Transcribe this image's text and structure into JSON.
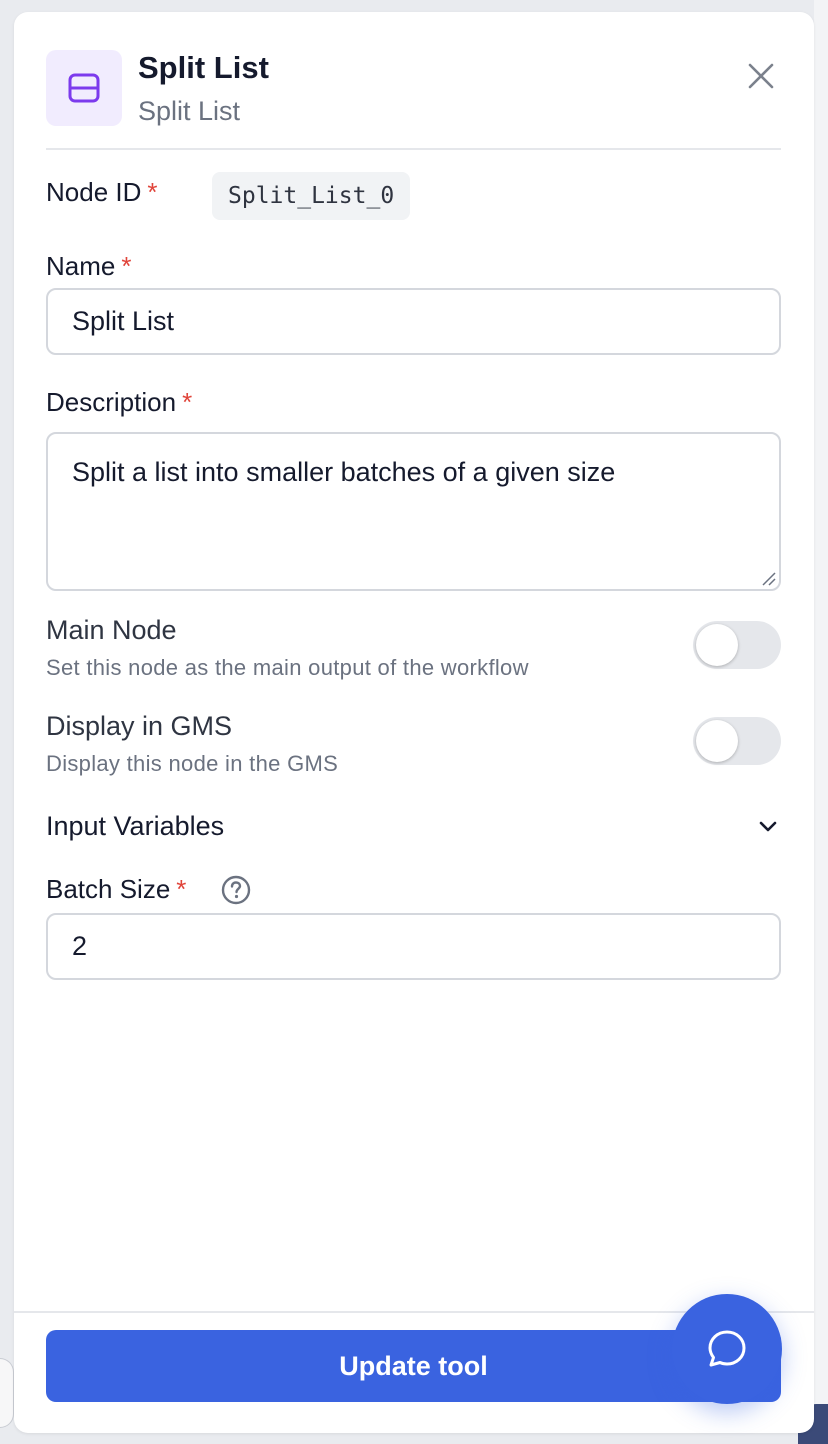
{
  "header": {
    "title": "Split List",
    "subtitle": "Split List",
    "icon": "split-panel-icon",
    "accent_color": "#7c3aed"
  },
  "node_id": {
    "label": "Node ID",
    "required_mark": "*",
    "value": "Split_List_0"
  },
  "name": {
    "label": "Name",
    "required_mark": "*",
    "value": "Split List"
  },
  "description": {
    "label": "Description",
    "required_mark": "*",
    "value": "Split a list into smaller batches of a given size"
  },
  "main_node": {
    "title": "Main Node",
    "description": "Set this node as the main output of the workflow",
    "enabled": false
  },
  "display_gms": {
    "title": "Display in GMS",
    "description": "Display this node in the GMS",
    "enabled": false
  },
  "input_variables": {
    "title": "Input Variables",
    "expanded": true
  },
  "batch_size": {
    "label": "Batch Size",
    "required_mark": "*",
    "value": "2"
  },
  "footer": {
    "primary_label": "Update tool",
    "primary_color": "#3a63e0"
  }
}
